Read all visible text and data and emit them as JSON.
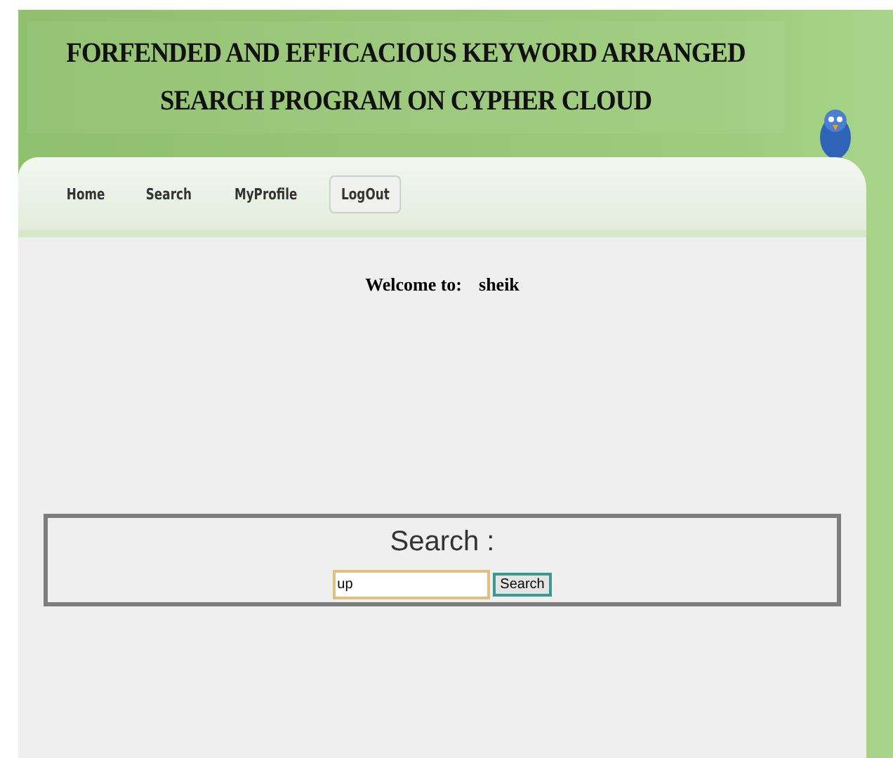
{
  "header": {
    "title": "FORFENDED AND EFFICACIOUS KEYWORD ARRANGED SEARCH PROGRAM ON CYPHER CLOUD"
  },
  "nav": [
    {
      "label": "Home",
      "selected": false
    },
    {
      "label": "Search",
      "selected": false
    },
    {
      "label": "MyProfile",
      "selected": false
    },
    {
      "label": "LogOut",
      "selected": true
    }
  ],
  "welcome": {
    "label": "Welcome to:",
    "user": "sheik"
  },
  "search": {
    "heading": "Search :",
    "value": "up",
    "button": "Search"
  }
}
